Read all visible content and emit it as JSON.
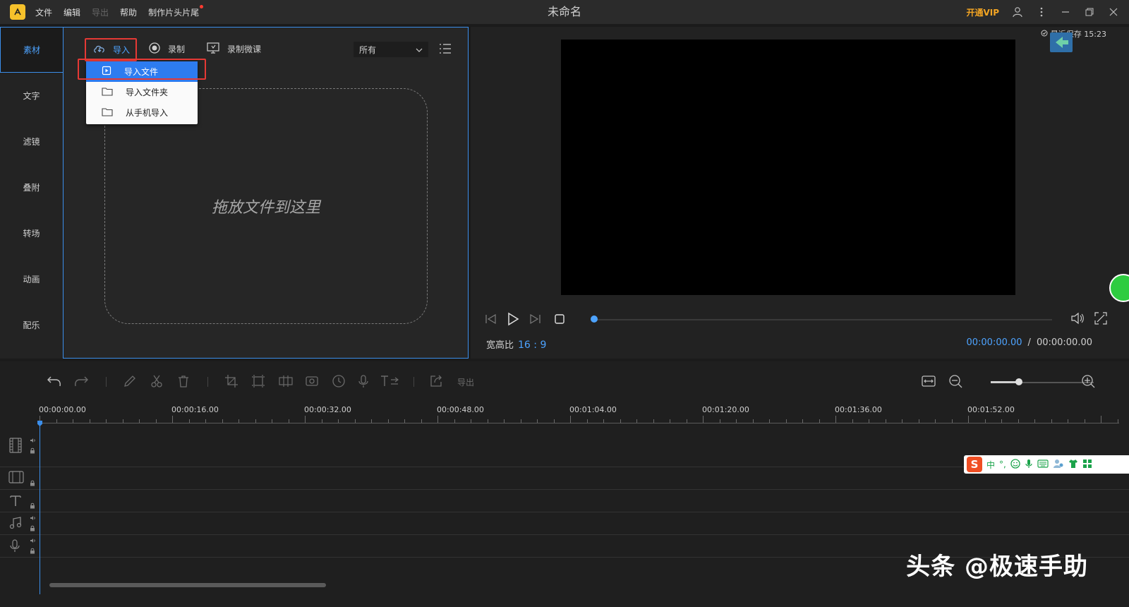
{
  "app": {
    "title": "未命名",
    "menu": [
      "文件",
      "编辑",
      "导出",
      "帮助",
      "制作片头片尾"
    ],
    "vip_label": "开通VIP",
    "saved_label": "最近保存 15:23"
  },
  "sidebar": {
    "items": [
      {
        "label": "素材"
      },
      {
        "label": "文字"
      },
      {
        "label": "滤镜"
      },
      {
        "label": "叠附"
      },
      {
        "label": "转场"
      },
      {
        "label": "动画"
      },
      {
        "label": "配乐"
      }
    ]
  },
  "media": {
    "import_label": "导入",
    "record_label": "录制",
    "record_class_label": "录制微课",
    "filter_value": "所有",
    "dropzone_text": "拖放文件到这里",
    "dropdown": [
      "导入文件",
      "导入文件夹",
      "从手机导入"
    ]
  },
  "preview": {
    "aspect_label": "宽高比",
    "aspect_value": "16 : 9",
    "current_time": "00:00:00.00",
    "time_separator": "/",
    "total_time": "00:00:00.00"
  },
  "timeline": {
    "export_label": "导出",
    "ruler": [
      "00:00:00.00",
      "00:00:16.00",
      "00:00:32.00",
      "00:00:48.00",
      "00:01:04.00",
      "00:01:20.00",
      "00:01:36.00",
      "00:01:52.00"
    ]
  },
  "ime": {
    "logo": "S",
    "lang": "中",
    "punct": "°,"
  },
  "watermark": "头条 @极速手助",
  "colors": {
    "accent": "#3b8eea",
    "highlight_box": "#e53935",
    "vip": "#f5a623"
  }
}
